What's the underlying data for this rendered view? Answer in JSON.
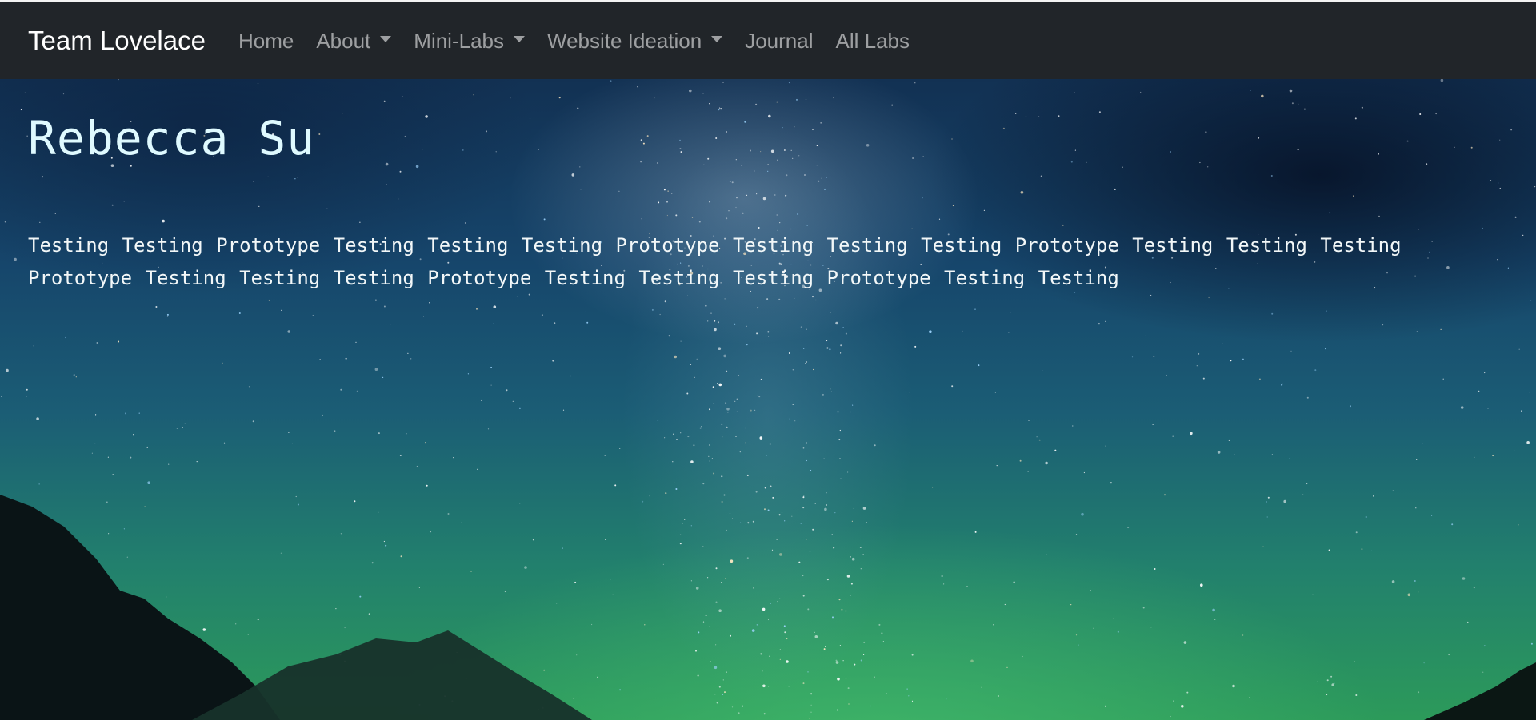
{
  "navbar": {
    "brand": "Team Lovelace",
    "items": [
      {
        "label": "Home",
        "dropdown": false
      },
      {
        "label": "About",
        "dropdown": true
      },
      {
        "label": "Mini-Labs",
        "dropdown": true
      },
      {
        "label": "Website Ideation",
        "dropdown": true
      },
      {
        "label": "Journal",
        "dropdown": false
      },
      {
        "label": "All Labs",
        "dropdown": false
      }
    ]
  },
  "main": {
    "title": "Rebecca Su",
    "paragraph": "Testing Testing Prototype Testing Testing Testing Prototype Testing Testing Testing Prototype Testing Testing Testing Prototype Testing Testing Testing Prototype Testing Testing Testing Prototype Testing Testing"
  },
  "colors": {
    "navbar_bg": "#212529",
    "brand_text": "#ffffff",
    "nav_text": "rgba(255,255,255,0.56)",
    "title_text": "#dffaff",
    "body_text": "#f2f7f8"
  },
  "icons": {
    "dropdown": "caret-down-icon"
  }
}
